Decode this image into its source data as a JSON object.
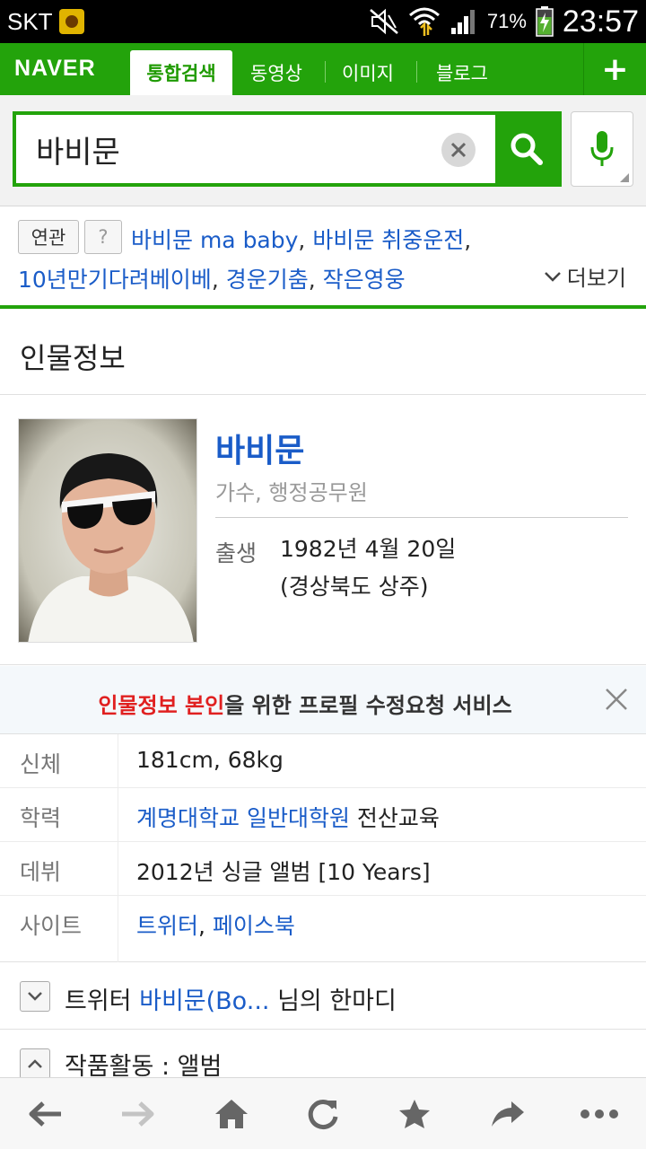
{
  "status_bar": {
    "carrier": "SKT",
    "battery": "71%",
    "time": "23:57"
  },
  "naver_tabs": {
    "logo": "NAVER",
    "active_tab": "통합검색",
    "tabs": [
      "동영상",
      "이미지",
      "블로그"
    ],
    "plus": "+",
    "accent_color": "#23a30b"
  },
  "search": {
    "query": "바비문"
  },
  "related": {
    "badge_label": "연관",
    "help_label": "?",
    "line1": [
      {
        "text": "바비문 ma baby",
        "sep": ", "
      },
      {
        "text": "바비문 취중운전",
        "sep": ","
      }
    ],
    "line2": [
      {
        "text": "10년만기다려베이베",
        "sep": ", "
      },
      {
        "text": "경운기춤",
        "sep": ", "
      },
      {
        "text": "작은영웅",
        "sep": ""
      }
    ],
    "more_label": "더보기"
  },
  "section": {
    "title": "인물정보"
  },
  "profile": {
    "name": "바비문",
    "job": "가수, 행정공무원",
    "birth_label": "출생",
    "birth_date": "1982년 4월 20일",
    "birth_place": "(경상북도 상주)"
  },
  "banner": {
    "red_text": "인물정보 본인",
    "rest_text": "을 위한 프로필 수정요청 서비스"
  },
  "info_rows": {
    "body_label": "신체",
    "body_value": "181cm, 68kg",
    "edu_label": "학력",
    "edu_link": "계명대학교 일반대학원",
    "edu_rest": " 전산교육",
    "debut_label": "데뷔",
    "debut_value": "2012년 싱글 앨범 [10 Years]",
    "site_label": "사이트",
    "site_link1": "트위터",
    "site_sep": ", ",
    "site_link2": "페이스북"
  },
  "twitter_row": {
    "prefix": "트위터 ",
    "link": "바비문(Bo...",
    "suffix": " 님의 한마디"
  },
  "works_row": {
    "text": "작품활동 : 앨범"
  }
}
